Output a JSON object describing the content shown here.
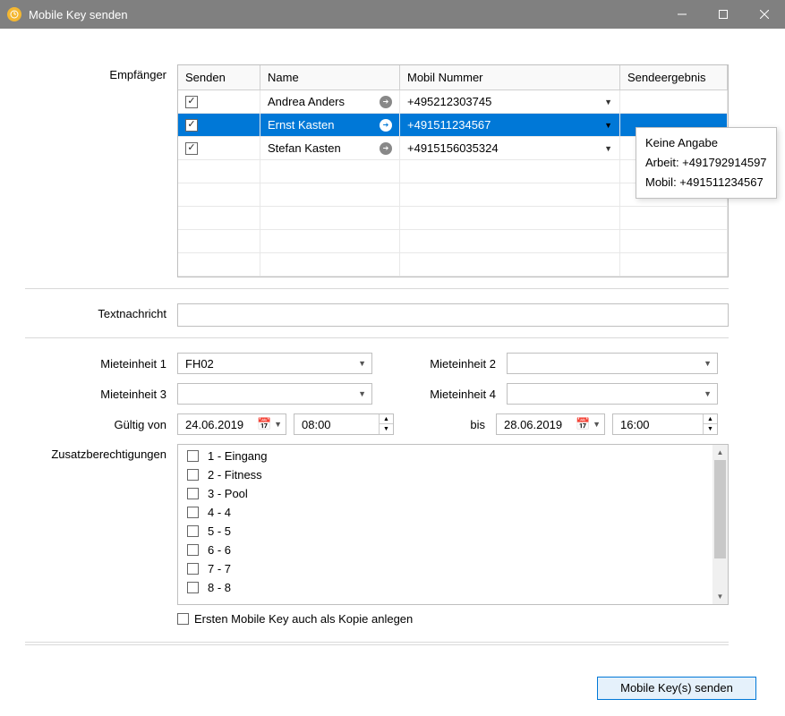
{
  "window": {
    "title": "Mobile Key senden"
  },
  "labels": {
    "recipients": "Empfänger",
    "textmessage": "Textnachricht",
    "unit1": "Mieteinheit 1",
    "unit2": "Mieteinheit 2",
    "unit3": "Mieteinheit 3",
    "unit4": "Mieteinheit 4",
    "validFrom": "Gültig von",
    "validTo": "bis",
    "extraPerms": "Zusatzberechtigungen",
    "copyKey": "Ersten Mobile Key auch als Kopie anlegen",
    "sendBtn": "Mobile Key(s) senden"
  },
  "table": {
    "headers": {
      "send": "Senden",
      "name": "Name",
      "mobile": "Mobil Nummer",
      "result": "Sendeergebnis"
    },
    "rows": [
      {
        "checked": true,
        "name": "Andrea Anders",
        "mobile": "+495212303745",
        "selected": false
      },
      {
        "checked": true,
        "name": "Ernst Kasten",
        "mobile": "+491511234567",
        "selected": true
      },
      {
        "checked": true,
        "name": "Stefan Kasten",
        "mobile": "+4915156035324",
        "selected": false
      }
    ]
  },
  "tooltip": {
    "line1": "Keine Angabe",
    "line2": "Arbeit: +491792914597",
    "line3": "Mobil: +491511234567"
  },
  "form": {
    "textmessage": "",
    "unit1": "FH02",
    "unit2": "",
    "unit3": "",
    "unit4": "",
    "dateFrom": "24.06.2019",
    "timeFrom": "08:00",
    "dateTo": "28.06.2019",
    "timeTo": "16:00"
  },
  "perms": [
    "1 - Eingang",
    "2 - Fitness",
    "3 - Pool",
    "4 - 4",
    "5 - 5",
    "6 - 6",
    "7 - 7",
    "8 - 8"
  ]
}
